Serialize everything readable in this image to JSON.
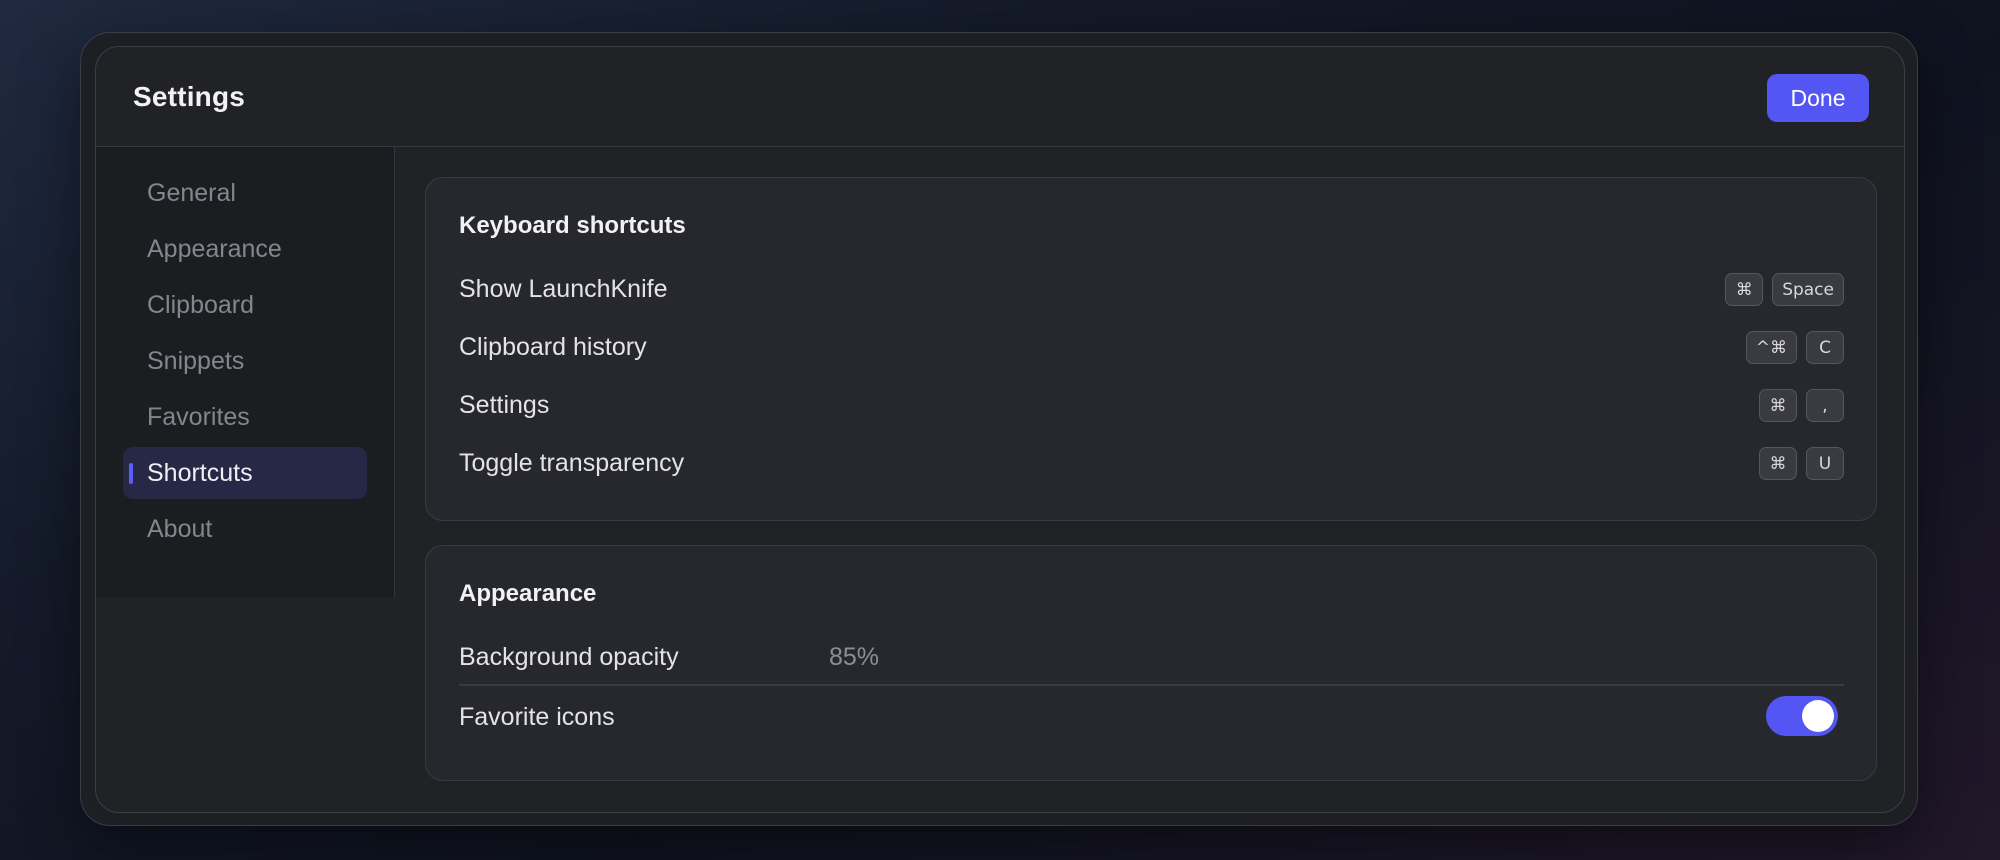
{
  "window": {
    "title": "Settings",
    "done_label": "Done"
  },
  "sidebar": {
    "items": [
      {
        "label": "General",
        "active": false
      },
      {
        "label": "Appearance",
        "active": false
      },
      {
        "label": "Clipboard",
        "active": false
      },
      {
        "label": "Snippets",
        "active": false
      },
      {
        "label": "Favorites",
        "active": false
      },
      {
        "label": "Shortcuts",
        "active": true
      },
      {
        "label": "About",
        "active": false
      }
    ]
  },
  "shortcuts_card": {
    "title": "Keyboard shortcuts",
    "rows": [
      {
        "label": "Show LaunchKnife",
        "keys": [
          "⌘",
          "Space"
        ]
      },
      {
        "label": "Clipboard history",
        "keys": [
          "^⌘",
          "C"
        ]
      },
      {
        "label": "Settings",
        "keys": [
          "⌘",
          ","
        ]
      },
      {
        "label": "Toggle transparency",
        "keys": [
          "⌘",
          "U"
        ]
      }
    ]
  },
  "appearance_card": {
    "title": "Appearance",
    "opacity_label": "Background opacity",
    "opacity_value": "85%",
    "favorite_icons_label": "Favorite icons",
    "favorite_icons_enabled": true
  },
  "colors": {
    "accent": "#5356f2",
    "window_bg": "#212226",
    "card_bg": "#27282d",
    "sidebar_bg": "#1c1d21"
  }
}
